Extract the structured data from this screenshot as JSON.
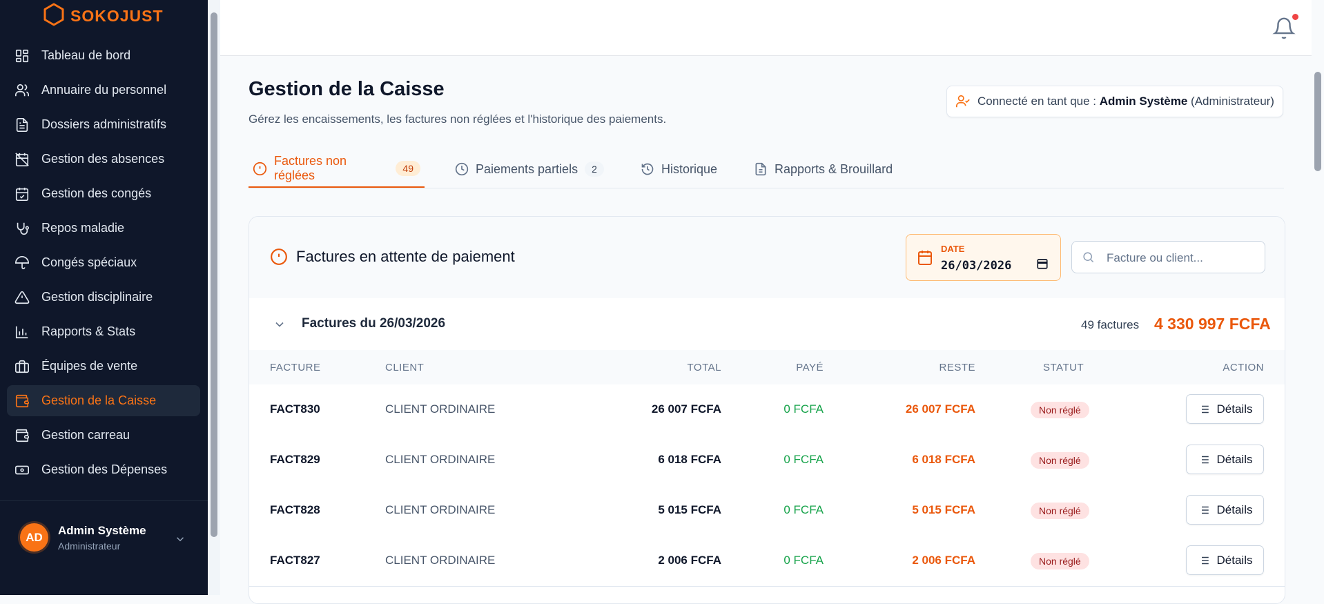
{
  "brand": {
    "name": "SOKOJUST"
  },
  "sidebar": {
    "items": [
      {
        "label": "Tableau de bord",
        "icon": "dashboard-icon"
      },
      {
        "label": "Annuaire du personnel",
        "icon": "users-icon"
      },
      {
        "label": "Dossiers administratifs",
        "icon": "document-icon"
      },
      {
        "label": "Gestion des absences",
        "icon": "calendar-x-icon"
      },
      {
        "label": "Gestion des congés",
        "icon": "calendar-check-icon"
      },
      {
        "label": "Repos maladie",
        "icon": "stethoscope-icon"
      },
      {
        "label": "Congés spéciaux",
        "icon": "umbrella-icon"
      },
      {
        "label": "Gestion disciplinaire",
        "icon": "warning-icon"
      },
      {
        "label": "Rapports & Stats",
        "icon": "bar-chart-icon"
      },
      {
        "label": "Équipes de vente",
        "icon": "briefcase-icon"
      },
      {
        "label": "Gestion de la Caisse",
        "icon": "wallet-icon",
        "active": true
      },
      {
        "label": "Gestion carreau",
        "icon": "wallet-icon"
      },
      {
        "label": "Gestion des Dépenses",
        "icon": "banknote-icon"
      }
    ]
  },
  "user": {
    "initials": "AD",
    "name": "Admin Système",
    "role": "Administrateur"
  },
  "header": {
    "title": "Gestion de la Caisse",
    "subtitle": "Gérez les encaissements, les factures non réglées et l'historique des paiements.",
    "connected_prefix": "Connecté en tant que :",
    "connected_user": "Admin Système",
    "connected_role": "(Administrateur)"
  },
  "tabs": [
    {
      "label": "Factures non réglées",
      "badge": "49",
      "icon": "alert-circle-icon",
      "active": true
    },
    {
      "label": "Paiements partiels",
      "badge": "2",
      "icon": "clock-icon"
    },
    {
      "label": "Historique",
      "icon": "history-icon"
    },
    {
      "label": "Rapports & Brouillard",
      "icon": "file-icon"
    }
  ],
  "card": {
    "title": "Factures en attente de paiement",
    "date_label": "DATE",
    "date_value": "26/03/2026",
    "search_placeholder": "Facture ou client...",
    "group_title": "Factures du 26/03/2026",
    "group_count": "49 factures",
    "group_total": "4 330 997 FCFA"
  },
  "table": {
    "columns": [
      "FACTURE",
      "CLIENT",
      "TOTAL",
      "PAYÉ",
      "RESTE",
      "STATUT",
      "ACTION"
    ],
    "action_label": "Détails",
    "rows": [
      {
        "facture": "FACT830",
        "client": "CLIENT ORDINAIRE",
        "total": "26 007 FCFA",
        "paye": "0 FCFA",
        "reste": "26 007 FCFA",
        "statut": "Non réglé"
      },
      {
        "facture": "FACT829",
        "client": "CLIENT ORDINAIRE",
        "total": "6 018 FCFA",
        "paye": "0 FCFA",
        "reste": "6 018 FCFA",
        "statut": "Non réglé"
      },
      {
        "facture": "FACT828",
        "client": "CLIENT ORDINAIRE",
        "total": "5 015 FCFA",
        "paye": "0 FCFA",
        "reste": "5 015 FCFA",
        "statut": "Non réglé"
      },
      {
        "facture": "FACT827",
        "client": "CLIENT ORDINAIRE",
        "total": "2 006 FCFA",
        "paye": "0 FCFA",
        "reste": "2 006 FCFA",
        "statut": "Non réglé"
      }
    ]
  },
  "colors": {
    "accent": "#f97316",
    "sidebar_bg": "#0f172a",
    "paid": "#16a34a",
    "status_bg": "#fee2e2"
  }
}
